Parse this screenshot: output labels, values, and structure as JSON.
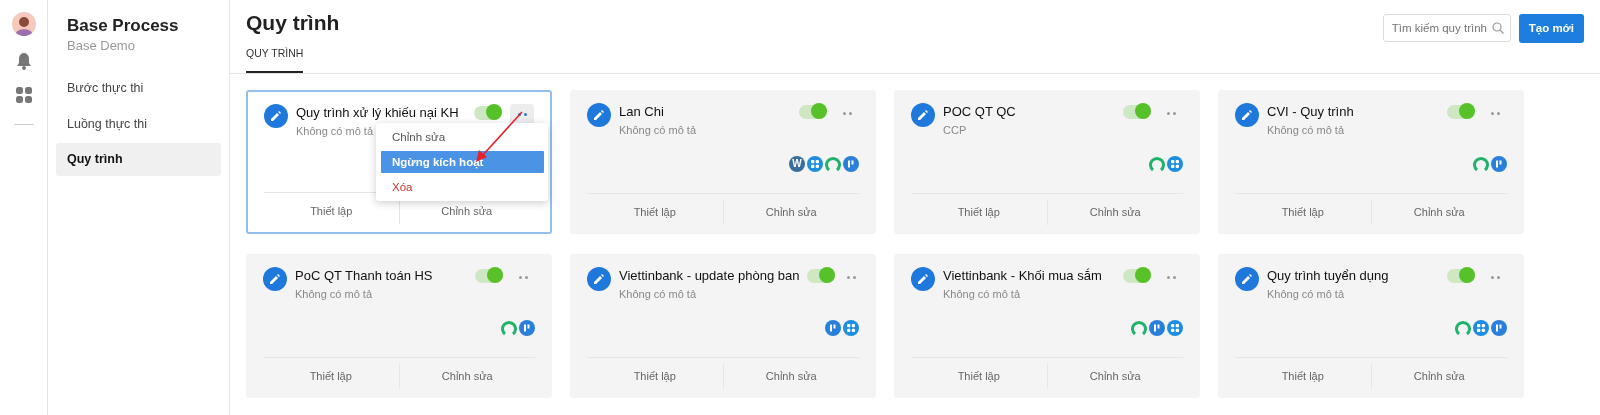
{
  "sidebar": {
    "title": "Base Process",
    "subtitle": "Base Demo",
    "items": [
      {
        "label": "Bước thực thi",
        "selected": false
      },
      {
        "label": "Luồng thực thi",
        "selected": false
      },
      {
        "label": "Quy trình",
        "selected": true
      }
    ]
  },
  "header": {
    "title": "Quy trình",
    "tabs": [
      {
        "label": "QUY TRÌNH",
        "selected": true
      }
    ],
    "search": {
      "placeholder": "Tìm kiếm quy trình"
    },
    "create_button": "Tạo mới"
  },
  "cards": [
    {
      "title": "Quy trình xử lý khiếu nại KH",
      "description": "Không có mô tả",
      "on": true,
      "active": true,
      "actions": [
        "Thiết lập",
        "Chỉnh sửa"
      ],
      "menu": [
        {
          "label": "Chỉnh sửa",
          "kind": "normal",
          "selected": false
        },
        {
          "label": "Ngừng kích hoạt",
          "kind": "normal",
          "selected": true
        },
        {
          "label": "Xóa",
          "kind": "danger",
          "selected": false
        }
      ]
    },
    {
      "title": "Lan Chi",
      "description": "Không có mô tả",
      "on": true,
      "active": false,
      "apps": [
        {
          "kind": "letter",
          "text": "W"
        },
        {
          "kind": "grid"
        },
        {
          "kind": "ring"
        },
        {
          "kind": "bars"
        }
      ],
      "actions": [
        "Thiết lập",
        "Chỉnh sửa"
      ]
    },
    {
      "title": "POC QT QC",
      "description": "CCP",
      "on": true,
      "active": false,
      "apps": [
        {
          "kind": "ring"
        },
        {
          "kind": "grid"
        }
      ],
      "actions": [
        "Thiết lập",
        "Chỉnh sửa"
      ]
    },
    {
      "title": "CVI - Quy trình",
      "description": "Không có mô tả",
      "on": true,
      "active": false,
      "apps": [
        {
          "kind": "ring"
        },
        {
          "kind": "bars"
        }
      ],
      "actions": [
        "Thiết lập",
        "Chỉnh sửa"
      ]
    },
    {
      "title": "PoC QT Thanh toán HS",
      "description": "Không có mô tả",
      "on": true,
      "active": false,
      "apps": [
        {
          "kind": "ring"
        },
        {
          "kind": "bars"
        }
      ],
      "actions": [
        "Thiết lập",
        "Chỉnh sửa"
      ]
    },
    {
      "title": "Viettinbank - update phòng ban",
      "description": "Không có mô tả",
      "on": true,
      "active": false,
      "apps": [
        {
          "kind": "bars"
        },
        {
          "kind": "grid"
        }
      ],
      "actions": [
        "Thiết lập",
        "Chỉnh sửa"
      ]
    },
    {
      "title": "Viettinbank - Khối mua sắm",
      "description": "Không có mô tả",
      "on": true,
      "active": false,
      "apps": [
        {
          "kind": "ring"
        },
        {
          "kind": "bars"
        },
        {
          "kind": "grid"
        }
      ],
      "actions": [
        "Thiết lập",
        "Chỉnh sửa"
      ]
    },
    {
      "title": "Quy trình tuyển dụng",
      "description": "Không có mô tả",
      "on": true,
      "active": false,
      "apps": [
        {
          "kind": "ring"
        },
        {
          "kind": "grid"
        },
        {
          "kind": "bars"
        }
      ],
      "actions": [
        "Thiết lập",
        "Chỉnh sửa"
      ]
    }
  ]
}
